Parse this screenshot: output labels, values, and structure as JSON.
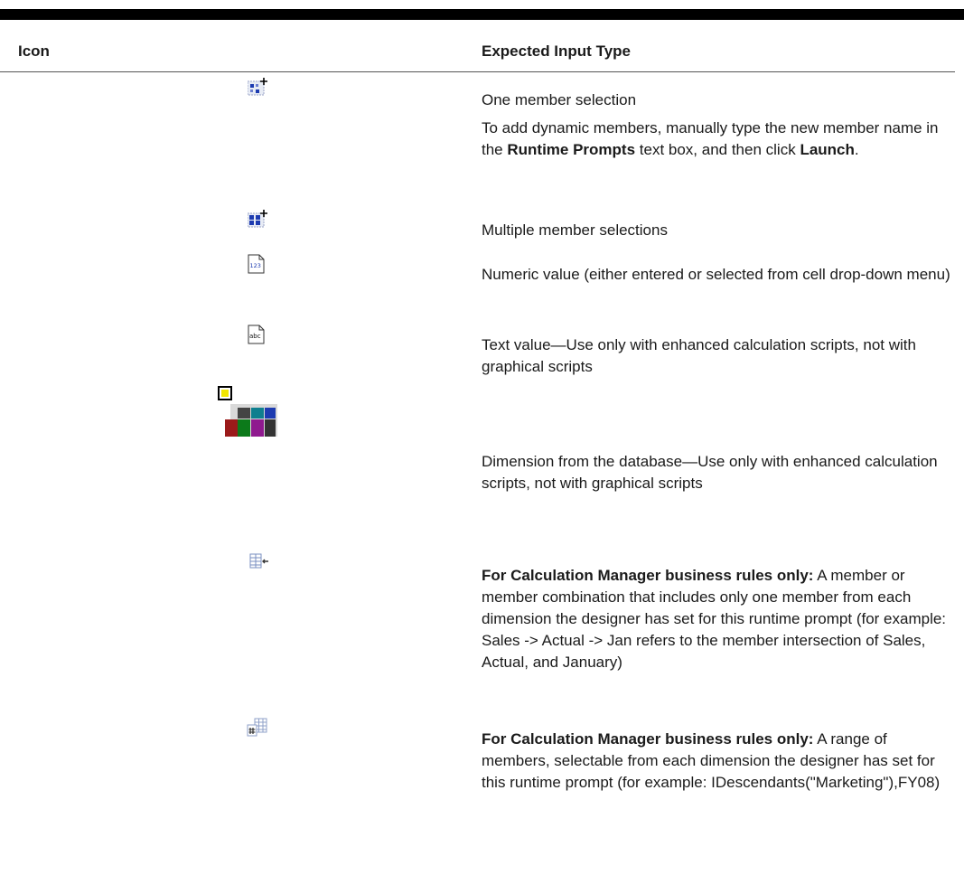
{
  "header": {
    "icon_col": "Icon",
    "type_col": "Expected Input Type"
  },
  "rows": [
    {
      "icon": "one-member-selection-icon",
      "line1": "One member selection",
      "line2_pre": "To add dynamic members, manually type the new member name in the ",
      "line2_bold1": "Runtime Prompts",
      "line2_mid": " text box, and then click ",
      "line2_bold2": "Launch",
      "line2_end": "."
    },
    {
      "icon": "multiple-member-selection-icon",
      "text": "Multiple member selections"
    },
    {
      "icon": "numeric-value-icon",
      "icon_text": "123",
      "text": "Numeric value (either entered or selected from cell drop-down menu)"
    },
    {
      "icon": "text-value-icon",
      "icon_text": "abc",
      "text": "Text value—Use only with enhanced calculation scripts, not with graphical scripts"
    },
    {
      "icon": "dimension-icon",
      "text": "Dimension from the database—Use only with enhanced calculation scripts, not with graphical scripts"
    },
    {
      "icon": "member-combination-icon",
      "bold": "For Calculation Manager business rules only:",
      "text": " A member or member combination that includes only one member from each dimension the designer has set for this runtime prompt (for example: Sales -> Actual -> Jan refers to the member intersection of Sales, Actual, and January)"
    },
    {
      "icon": "member-range-icon",
      "bold": "For Calculation Manager business rules only:",
      "text": " A range of members, selectable from each dimension the designer has set for this runtime prompt (for example: IDescendants(\"Marketing\"),FY08)"
    }
  ]
}
